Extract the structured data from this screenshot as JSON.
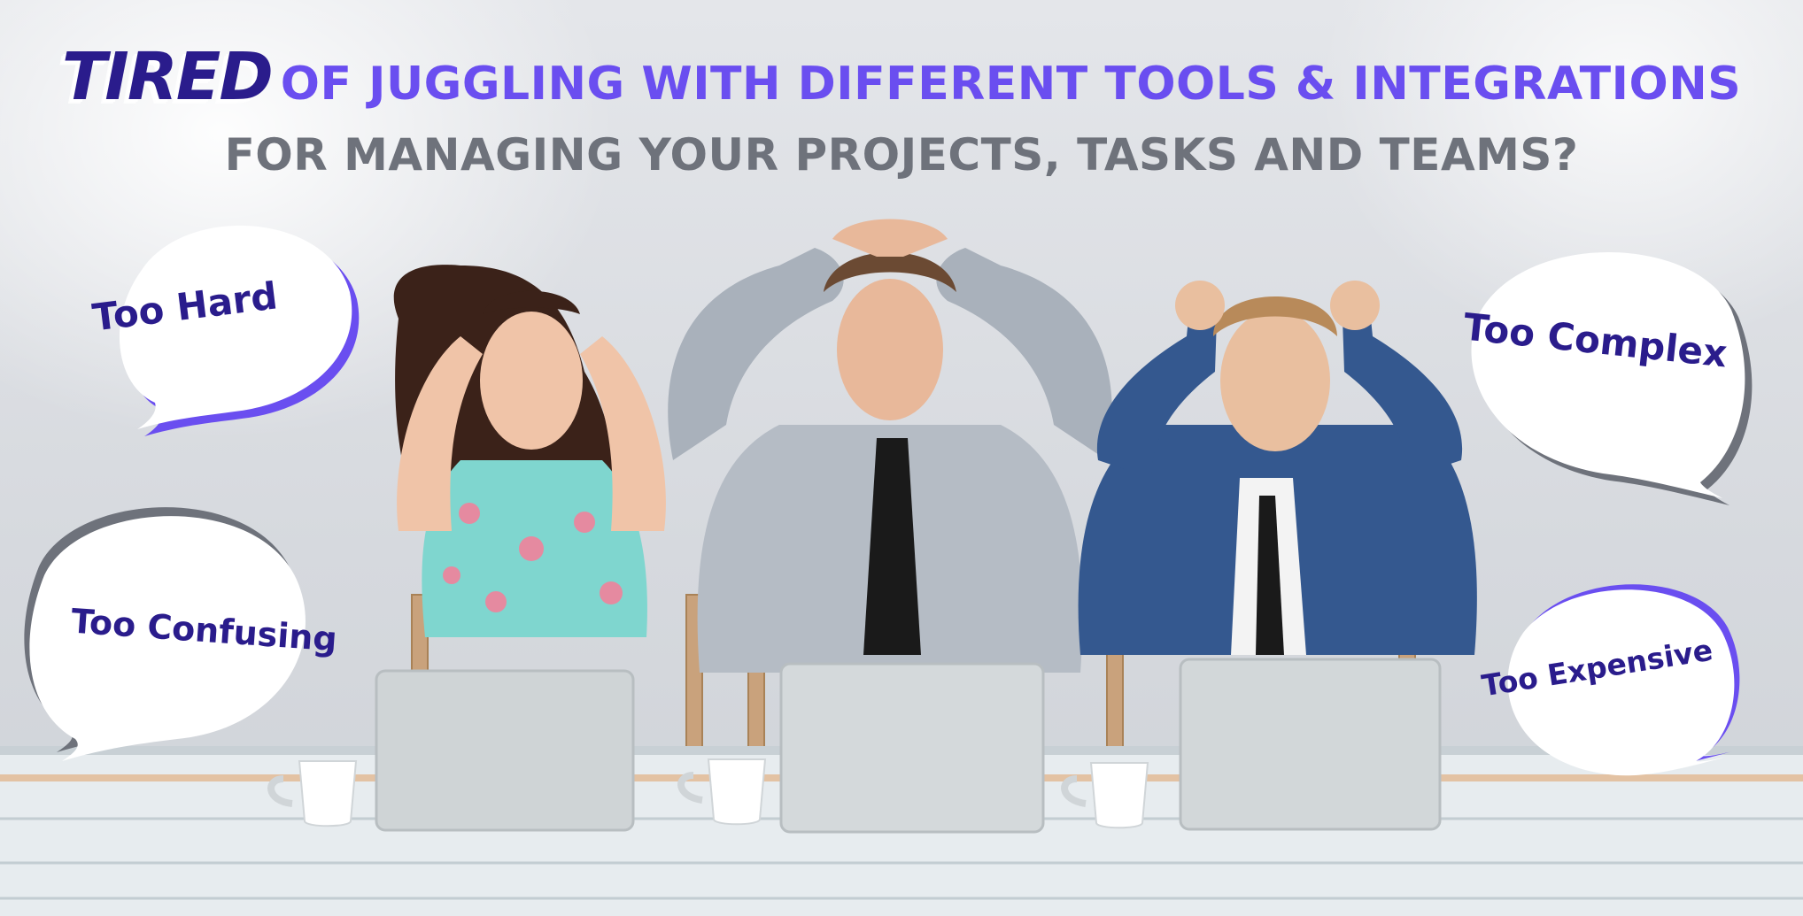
{
  "headline": {
    "emphasis": "TIRED",
    "line1_rest": "OF JUGGLING WITH DIFFERENT TOOLS & INTEGRATIONS",
    "line2": "FOR MANAGING YOUR PROJECTS, TASKS AND TEAMS?"
  },
  "bubbles": {
    "hard": "Too Hard",
    "confusing": "Too Confusing",
    "complex": "Too Complex",
    "expensive": "Too Expensive"
  },
  "colors": {
    "emphasis": "#2a1c8c",
    "accent": "#6a4ef0",
    "subtitle": "#6e727b",
    "bubble_text": "#2a1c8c",
    "bubble_shadow_purple": "#6a4ef0",
    "bubble_shadow_gray": "#6e727b"
  }
}
